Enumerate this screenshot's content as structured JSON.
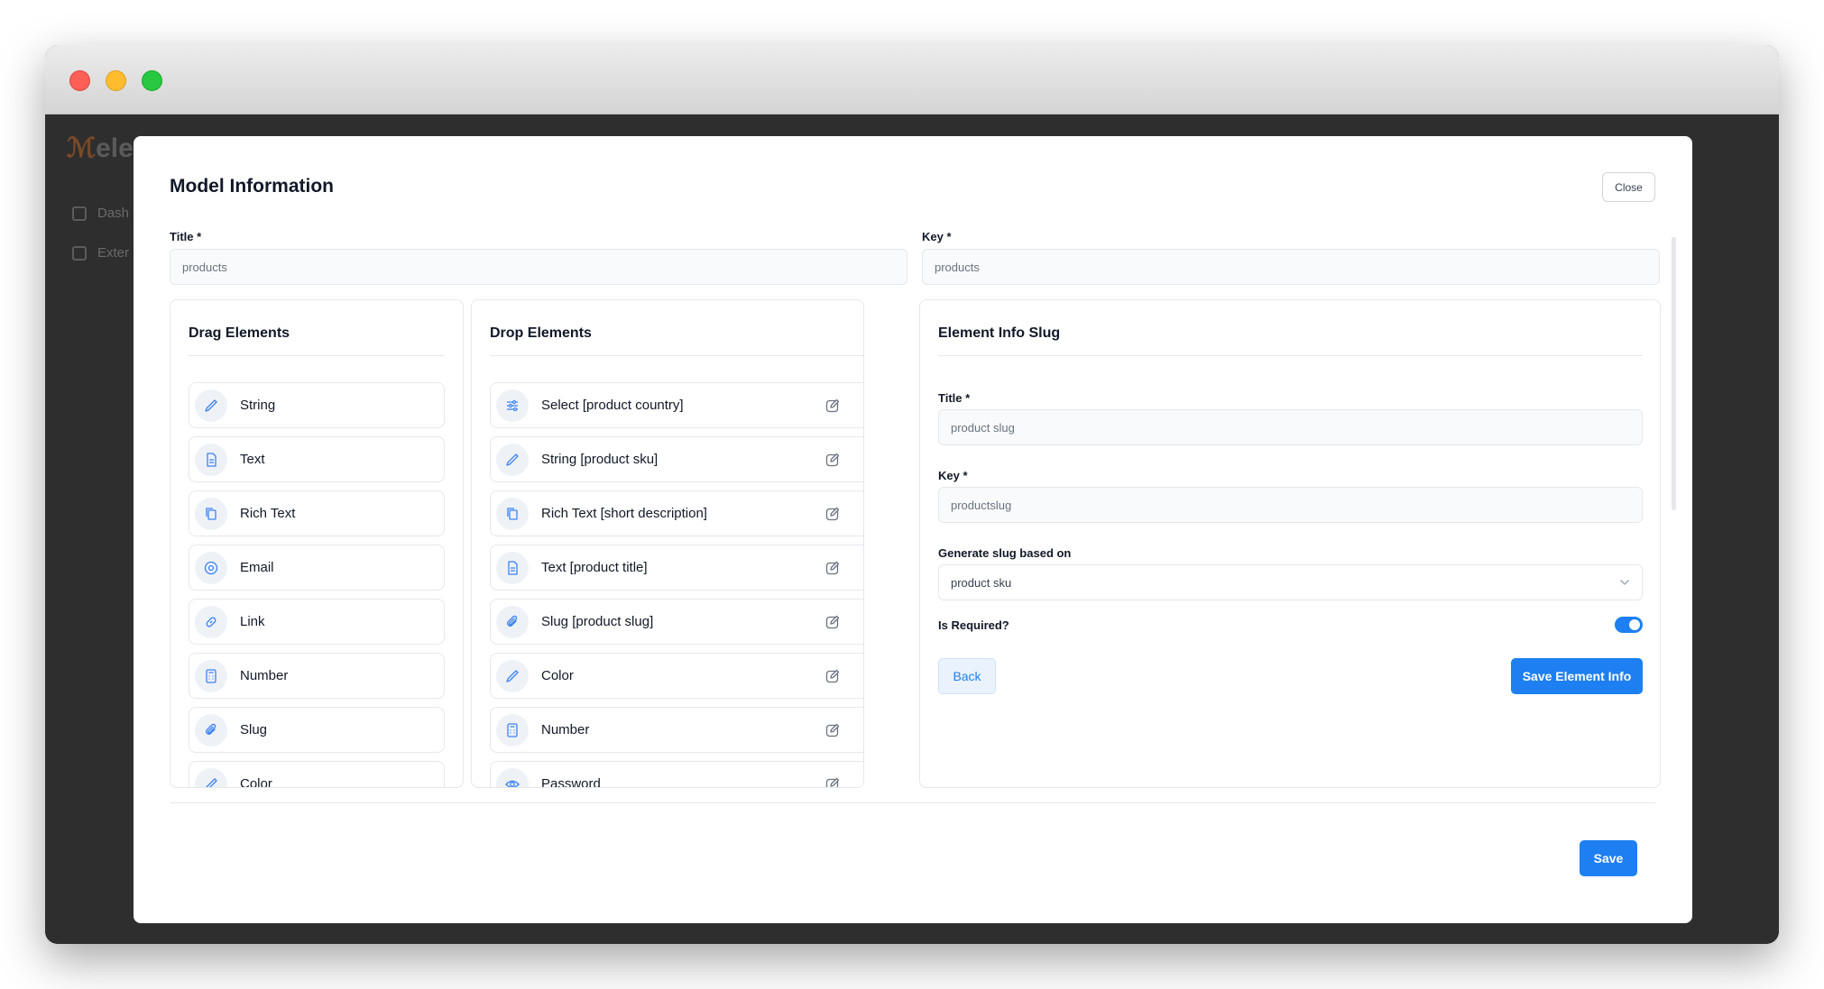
{
  "background_app": {
    "logo_text": "elen",
    "nav": [
      "Dash",
      "Exter"
    ]
  },
  "modal": {
    "title": "Model Information",
    "close_label": "Close",
    "title_field": {
      "label": "Title *",
      "value": "products"
    },
    "key_field": {
      "label": "Key *",
      "value": "products"
    },
    "save_label": "Save"
  },
  "drag_panel": {
    "title": "Drag Elements",
    "items": [
      {
        "label": "String",
        "icon": "pencil-icon"
      },
      {
        "label": "Text",
        "icon": "document-icon"
      },
      {
        "label": "Rich Text",
        "icon": "copy-icon"
      },
      {
        "label": "Email",
        "icon": "at-sign-icon"
      },
      {
        "label": "Link",
        "icon": "link-icon"
      },
      {
        "label": "Number",
        "icon": "calculator-icon"
      },
      {
        "label": "Slug",
        "icon": "paperclip-icon"
      },
      {
        "label": "Color",
        "icon": "pencil-icon"
      }
    ]
  },
  "drop_panel": {
    "title": "Drop Elements",
    "items": [
      {
        "label": "Select [product country]",
        "icon": "sliders-icon"
      },
      {
        "label": "String [product sku]",
        "icon": "pencil-icon"
      },
      {
        "label": "Rich Text [short description]",
        "icon": "copy-icon"
      },
      {
        "label": "Text [product title]",
        "icon": "document-icon"
      },
      {
        "label": "Slug [product slug]",
        "icon": "paperclip-icon"
      },
      {
        "label": "Color",
        "icon": "pencil-icon"
      },
      {
        "label": "Number",
        "icon": "calculator-icon"
      },
      {
        "label": "Password",
        "icon": "eye-icon"
      }
    ]
  },
  "info_panel": {
    "title": "Element Info Slug",
    "title_field": {
      "label": "Title *",
      "value": "product slug"
    },
    "key_field": {
      "label": "Key *",
      "value": "productslug"
    },
    "slug_select": {
      "label": "Generate slug based on",
      "value": "product sku"
    },
    "required_label": "Is Required?",
    "required": true,
    "back_label": "Back",
    "save_info_label": "Save Element Info"
  },
  "colors": {
    "primary": "#1d7ff2",
    "icon_blue": "#3b82f6",
    "overlay": "#2e2e2e"
  }
}
